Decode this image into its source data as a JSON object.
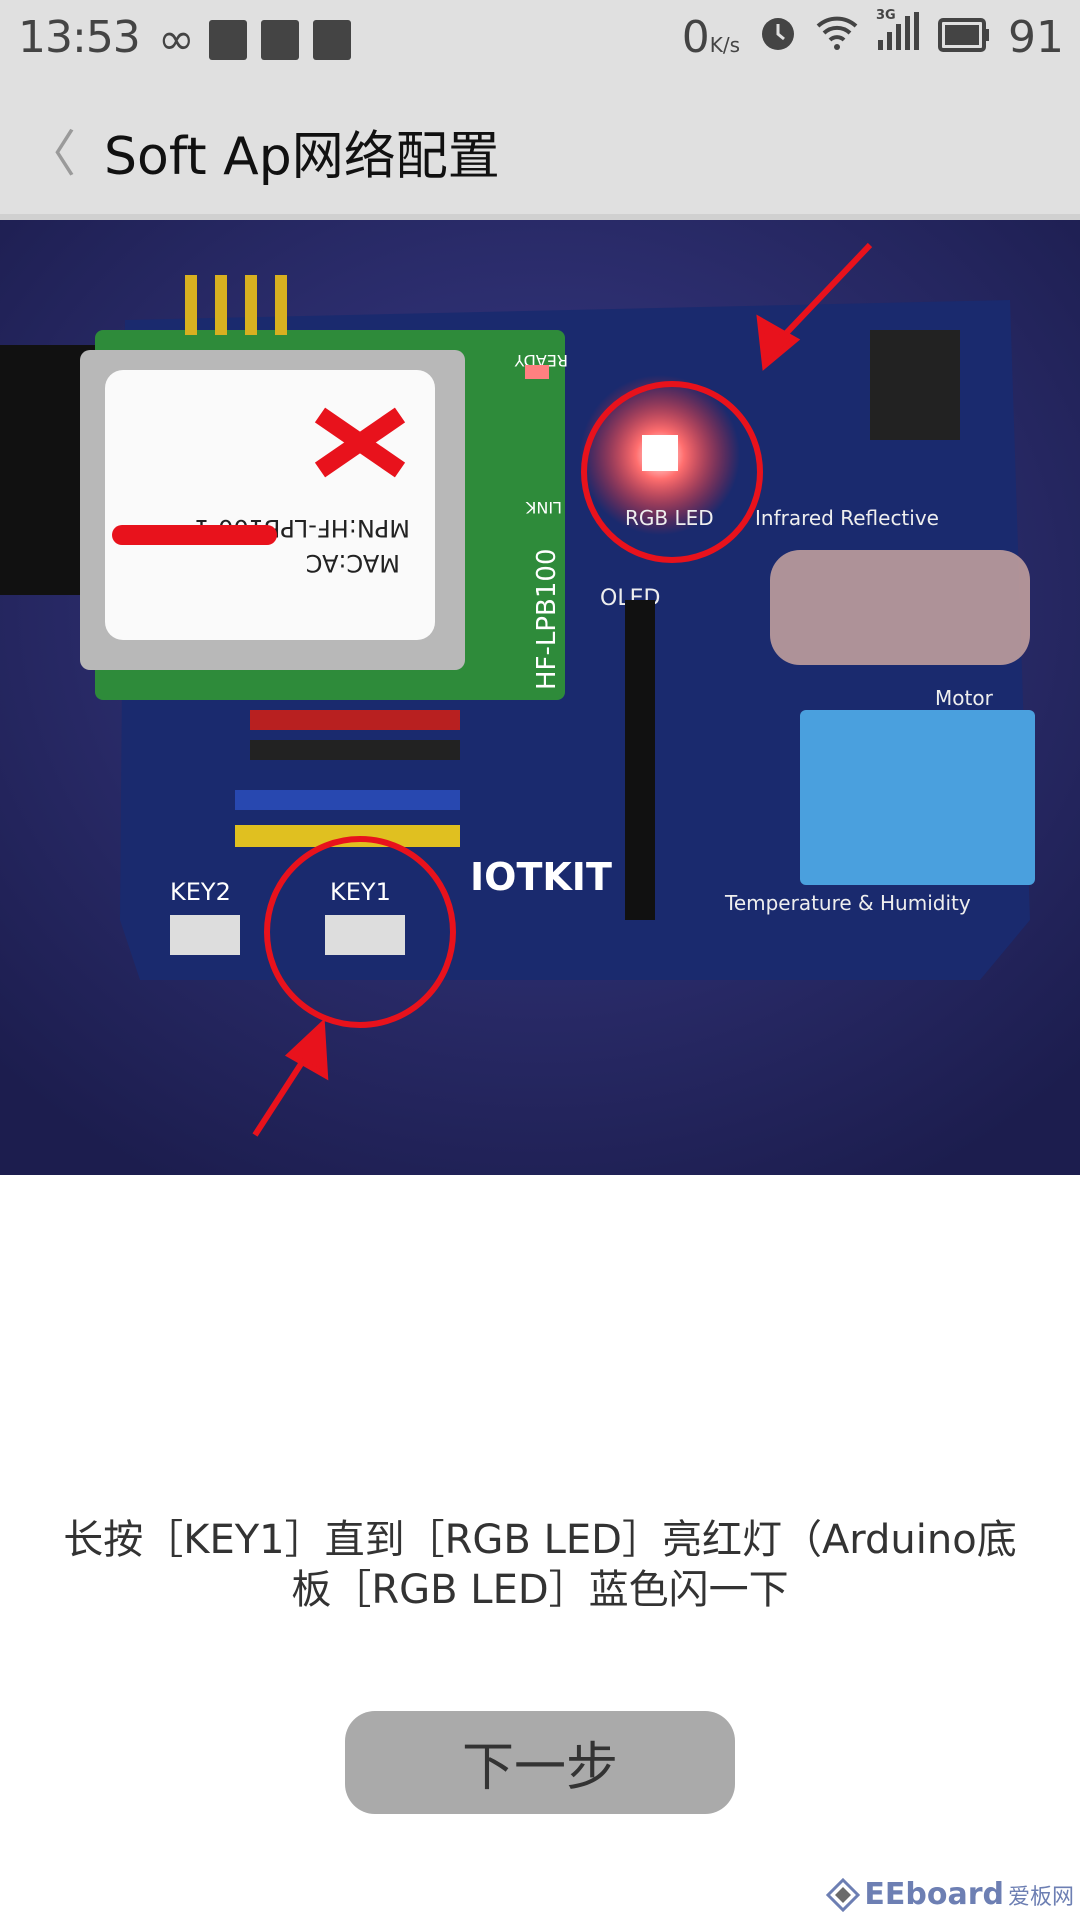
{
  "status_bar": {
    "time": "13:53",
    "left_icons": [
      "infinity-icon",
      "qq-icon",
      "image-icon",
      "qq-icon"
    ],
    "net_speed": "0",
    "net_speed_unit": "K/s",
    "right_icons": [
      "alarm-icon",
      "wifi-icon",
      "signal-3g-icon",
      "battery-icon"
    ],
    "signal_type": "3G",
    "battery": "91"
  },
  "header": {
    "back_icon": "chevron-left-icon",
    "back_glyph": "〈",
    "title": "Soft Ap网络配置"
  },
  "photo": {
    "labels": {
      "module_mpn": "MPN:HF-LPB100-1",
      "module_mac": "MAC:AC",
      "module_name": "HF-LPB100",
      "rgb_led": "RGB LED",
      "infrared": "Infrared Reflective",
      "oled": "OLED",
      "motor": "Motor",
      "iotkit": "IOTKIT",
      "key1": "KEY1",
      "key2": "KEY2",
      "temp_humidity": "Temperature & Humidity",
      "ready": "READY",
      "link": "LINK"
    },
    "highlight_color": "#e8121c"
  },
  "instruction": {
    "line1": "长按［KEY1］直到［RGB LED］亮红灯（Arduino底",
    "line2": "板［RGB LED］蓝色闪一下"
  },
  "next_button": {
    "label": "下一步"
  },
  "watermark": {
    "brand": "EEboard",
    "cn": "爱板网"
  }
}
